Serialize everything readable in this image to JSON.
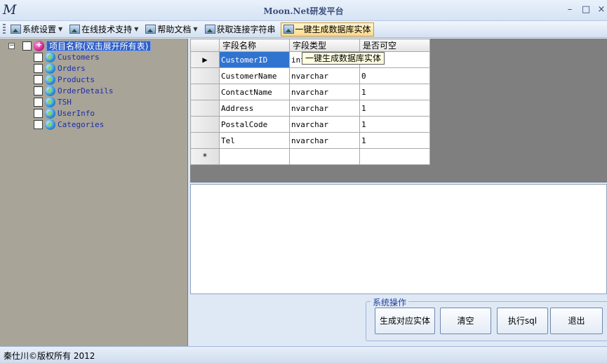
{
  "window": {
    "logo": "M",
    "title": "Moon.Net研发平台",
    "minimize_glyph": "–",
    "maximize_glyph": "□",
    "close_glyph": "×"
  },
  "toolbar": {
    "items": [
      {
        "label": "系统设置",
        "icon": "image-icon",
        "has_dropdown": true
      },
      {
        "label": "在线技术支持",
        "icon": "image-icon",
        "has_dropdown": true
      },
      {
        "label": "帮助文档",
        "icon": "image-icon",
        "has_dropdown": true
      },
      {
        "label": "获取连接字符串",
        "icon": "image-icon",
        "has_dropdown": false
      },
      {
        "label": "一键生成数据库实体",
        "icon": "image-icon",
        "has_dropdown": false,
        "active": true
      }
    ],
    "dropdown_glyph": "▼"
  },
  "tree": {
    "root_label": "项目名称(双击展开所有表)",
    "expander_glyph": "−",
    "tables": [
      "Customers",
      "Orders",
      "Products",
      "OrderDetails",
      "TSH",
      "UserInfo",
      "Categories"
    ]
  },
  "grid": {
    "columns": [
      "字段名称",
      "字段类型",
      "是否可空"
    ],
    "current_row_glyph": "▶",
    "new_row_glyph": "*",
    "rows": [
      [
        "CustomerID",
        "int",
        ""
      ],
      [
        "CustomerName",
        "nvarchar",
        "0"
      ],
      [
        "ContactName",
        "nvarchar",
        "1"
      ],
      [
        "Address",
        "nvarchar",
        "1"
      ],
      [
        "PostalCode",
        "nvarchar",
        "1"
      ],
      [
        "Tel",
        "nvarchar",
        "1"
      ]
    ]
  },
  "tooltip": "一键生成数据库实体",
  "sql_box": {
    "value": ""
  },
  "actions": {
    "group_title": "系统操作",
    "generate_label": "生成对应实体",
    "clear_label": "清空",
    "execute_label": "执行sql",
    "exit_label": "退出"
  },
  "status": {
    "text": "秦仕川©版权所有 2012"
  },
  "colors": {
    "tree_background": "#a8a498",
    "grid_background": "#807f80",
    "selection": "#3074cf",
    "tree_label": "#1c2ea8"
  }
}
